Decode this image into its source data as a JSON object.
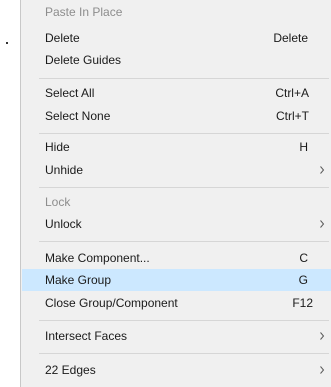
{
  "menu": {
    "items": [
      {
        "label": "Paste In Place",
        "shortcut": "",
        "submenu": false,
        "disabled": true,
        "selected": false
      },
      {
        "label": "Delete",
        "shortcut": "Delete",
        "submenu": false,
        "disabled": false,
        "selected": false
      },
      {
        "label": "Delete Guides",
        "shortcut": "",
        "submenu": false,
        "disabled": false,
        "selected": false
      },
      {
        "label": "Select All",
        "shortcut": "Ctrl+A",
        "submenu": false,
        "disabled": false,
        "selected": false
      },
      {
        "label": "Select None",
        "shortcut": "Ctrl+T",
        "submenu": false,
        "disabled": false,
        "selected": false
      },
      {
        "label": "Hide",
        "shortcut": "H",
        "submenu": false,
        "disabled": false,
        "selected": false
      },
      {
        "label": "Unhide",
        "shortcut": "",
        "submenu": true,
        "disabled": false,
        "selected": false
      },
      {
        "label": "Lock",
        "shortcut": "",
        "submenu": false,
        "disabled": true,
        "selected": false
      },
      {
        "label": "Unlock",
        "shortcut": "",
        "submenu": true,
        "disabled": false,
        "selected": false
      },
      {
        "label": "Make Component...",
        "shortcut": "C",
        "submenu": false,
        "disabled": false,
        "selected": false
      },
      {
        "label": "Make Group",
        "shortcut": "G",
        "submenu": false,
        "disabled": false,
        "selected": true
      },
      {
        "label": "Close Group/Component",
        "shortcut": "F12",
        "submenu": false,
        "disabled": false,
        "selected": false
      },
      {
        "label": "Intersect Faces",
        "shortcut": "",
        "submenu": true,
        "disabled": false,
        "selected": false
      },
      {
        "label": "22 Edges",
        "shortcut": "",
        "submenu": true,
        "disabled": false,
        "selected": false
      }
    ]
  },
  "colors": {
    "menu_background": "#f0f0f0",
    "highlight": "#cce8ff",
    "disabled_text": "#8d8d8d",
    "separator": "#d6d6d6"
  },
  "icons": {
    "submenu": "chevron-right-icon"
  }
}
